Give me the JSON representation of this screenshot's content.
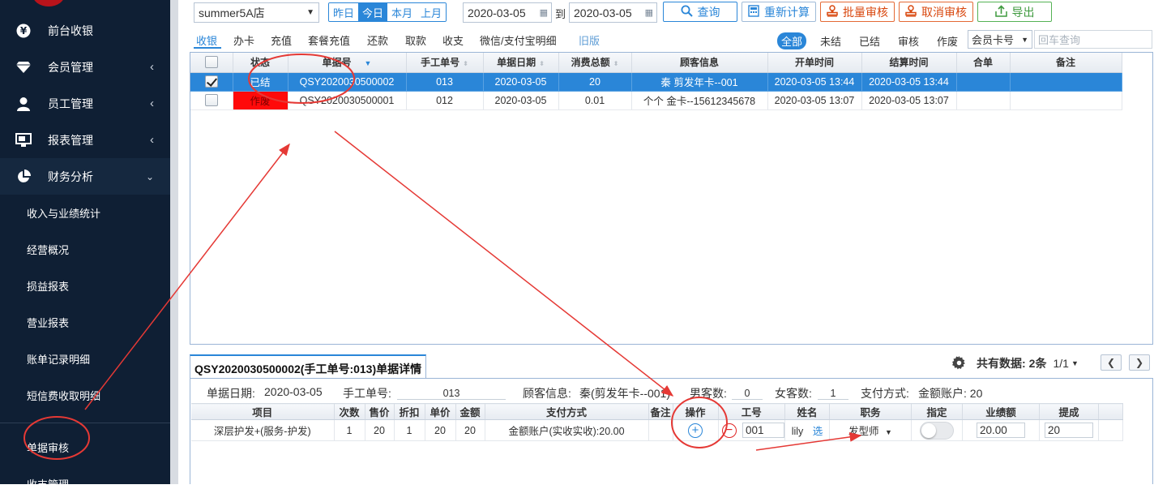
{
  "sidebar": {
    "items": [
      {
        "label": "前台收银",
        "icon": "yen-icon",
        "chevron": false
      },
      {
        "label": "会员管理",
        "icon": "diamond-icon",
        "chevron": true
      },
      {
        "label": "员工管理",
        "icon": "user-icon",
        "chevron": true
      },
      {
        "label": "报表管理",
        "icon": "monitor-icon",
        "chevron": true
      },
      {
        "label": "财务分析",
        "icon": "pie-chart-icon",
        "chevron": true,
        "expanded": true
      }
    ],
    "sub_items": [
      "收入与业绩统计",
      "经营概况",
      "损益报表",
      "营业报表",
      "账单记录明细",
      "短信费收取明细",
      "单据审核",
      "收支管理"
    ]
  },
  "toolbar": {
    "store": "summer5A店",
    "quick_dates": [
      "昨日",
      "今日",
      "本月",
      "上月"
    ],
    "active_quick_date": "今日",
    "date_from": "2020-03-05",
    "to_label": "到",
    "date_to": "2020-03-05",
    "query": "查询",
    "recalc": "重新计算",
    "batch_audit": "批量审核",
    "cancel_audit": "取消审核",
    "export": "导出"
  },
  "tabs": [
    "收银",
    "办卡",
    "充值",
    "套餐充值",
    "还款",
    "取款",
    "收支",
    "微信/支付宝明细",
    "旧版"
  ],
  "active_tab": "收银",
  "filters": [
    "全部",
    "未结",
    "已结",
    "审核",
    "作废"
  ],
  "active_filter": "全部",
  "member_select": "会员卡号",
  "search_placeholder": "回车查询",
  "main_table": {
    "columns": [
      "",
      "状态",
      "单据号",
      "手工单号",
      "单据日期",
      "消费总额",
      "顾客信息",
      "开单时间",
      "结算时间",
      "合单",
      "备注"
    ],
    "rows": [
      {
        "checked": true,
        "status": "已结",
        "bill_no": "QSY2020030500002",
        "manual_no": "013",
        "date": "2020-03-05",
        "total": "20",
        "customer": "秦 剪发年卡--001",
        "open_time": "2020-03-05 13:44",
        "settle_time": "2020-03-05 13:44",
        "merge": "",
        "remark": ""
      },
      {
        "checked": false,
        "status": "作废",
        "bill_no": "QSY2020030500001",
        "manual_no": "012",
        "date": "2020-03-05",
        "total": "0.01",
        "customer": "个个 金卡--15612345678",
        "open_time": "2020-03-05 13:07",
        "settle_time": "2020-03-05 13:07",
        "merge": "",
        "remark": ""
      }
    ]
  },
  "detail": {
    "title": "QSY2020030500002(手工单号:013)单据详情",
    "total_label": "共有数据:",
    "total_value": "2条",
    "page": "1/1",
    "bill_date_label": "单据日期:",
    "bill_date": "2020-03-05",
    "manual_label": "手工单号:",
    "manual_no": "013",
    "customer_label": "顾客信息:",
    "customer": "秦(剪发年卡--001)",
    "male_label": "男客数:",
    "male": "0",
    "female_label": "女客数:",
    "female": "1",
    "payment_label": "支付方式:",
    "payment": "金额账户: 20",
    "columns": [
      "项目",
      "次数",
      "售价",
      "折扣",
      "单价",
      "金额",
      "支付方式",
      "备注",
      "操作",
      "工号",
      "姓名",
      "职务",
      "指定",
      "业绩额",
      "提成"
    ],
    "row": {
      "item": "深层护发+(服务-护发)",
      "times": "1",
      "price": "20",
      "discount": "1",
      "unit_price": "20",
      "amount": "20",
      "pay": "金额账户(实收实收):20.00",
      "remark": "",
      "staff_no": "001",
      "name": "lily",
      "select": "选",
      "position": "发型师",
      "designated": false,
      "performance": "20.00",
      "commission": "20"
    }
  },
  "annotation_color": "#e53935"
}
